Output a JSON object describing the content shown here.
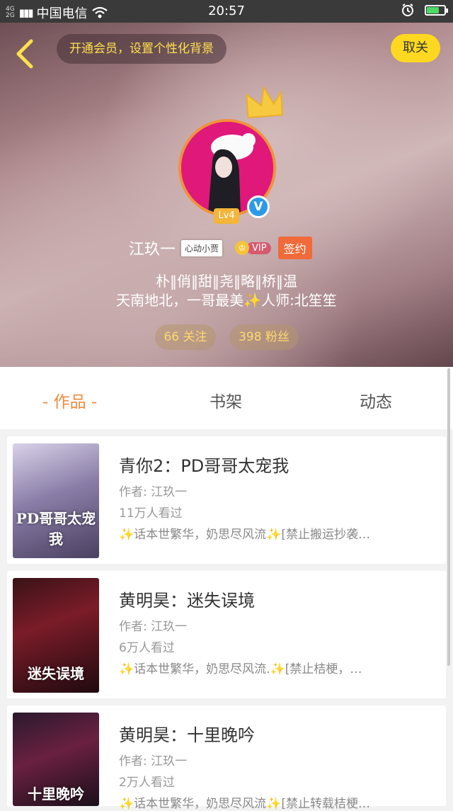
{
  "status_bar": {
    "network_type": "4G",
    "network_type_2": "2G",
    "carrier": "中国电信",
    "time": "20:57",
    "icons": [
      "signal-icon",
      "wifi-icon",
      "alarm-icon",
      "battery-charging-icon"
    ],
    "battery_level": 0.7,
    "battery_color": "#4cd964"
  },
  "header": {
    "vip_banner": "开通会员，设置个性化背景",
    "unfollow_label": "取关",
    "level": "Lv4",
    "verified_mark": "V",
    "username": "江玖一",
    "medal": "心动小贾",
    "vip_label": "VIP",
    "vip_icon": "♔",
    "sign_label": "签约",
    "bio_line1": "朴‖俏‖甜‖尧‖略‖桥‖温",
    "bio_line2": "天南地北，一哥最美✨人师:北笙笙",
    "following": "66 关注",
    "fans": "398 粉丝",
    "accent_color": "#fcd820"
  },
  "tabs": [
    {
      "label": "- 作品 -",
      "active": true
    },
    {
      "label": "书架",
      "active": false
    },
    {
      "label": "动态",
      "active": false
    }
  ],
  "books": [
    {
      "title": "青你2：PD哥哥太宠我",
      "author": "作者: 江玖一",
      "views": "11万人看过",
      "description": "✨话本世繁华，奶思尽风流✨[禁止搬运抄袭…",
      "cover_caption": "PD哥哥太宠我"
    },
    {
      "title": "黄明昊：迷失误境",
      "author": "作者: 江玖一",
      "views": "6万人看过",
      "description": "✨话本世繁华，奶思尽风流.✨[禁止桔梗，…",
      "cover_caption": "迷失误境"
    },
    {
      "title": "黄明昊：十里晚吟",
      "author": "作者: 江玖一",
      "views": "2万人看过",
      "description": "✨话本世繁华，奶思尽风流✨[禁止转载桔梗…",
      "cover_caption": "十里晚吟"
    }
  ]
}
